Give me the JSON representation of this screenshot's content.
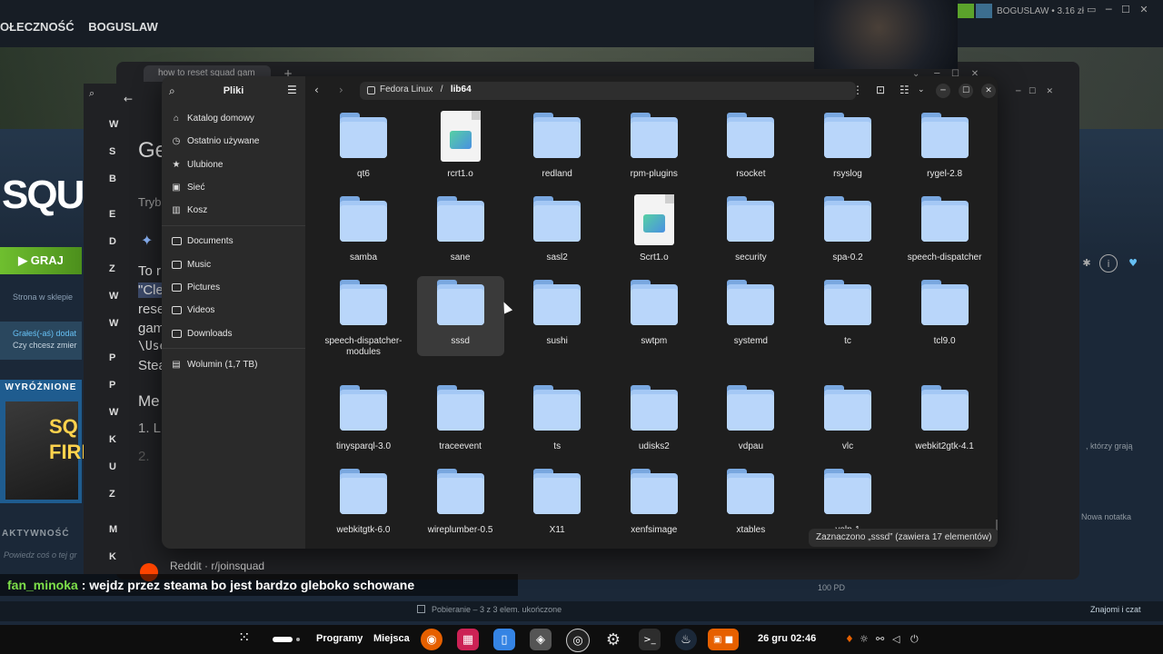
{
  "steam": {
    "nav": [
      "OŁECZNOŚĆ",
      "BOGUSLAW"
    ],
    "user": "BOGUSLAW • 3.16 zł",
    "logo": "SQUA",
    "play": "▶  GRAJ",
    "store_page": "Strona w sklepie",
    "played_line1": "Grałeś(-aś) dodat",
    "played_line2": "Czy chcesz zmier",
    "featured": "WYRÓŻNIONE",
    "featured_art": "SQ FIRE",
    "activity": "AKTYWNOŚĆ",
    "activity_placeholder": "Powiedz coś o tej gr",
    "friends_playing": ", którzy grają",
    "new_note": "Nowa notatka",
    "download": "Pobieranie – 3 z 3 elem. ukończone",
    "friends_chat": "Znajomi i czat",
    "size": "100 PD"
  },
  "browser": {
    "tab_title": "how to reset squad gam",
    "left_letters": [
      "W",
      "S",
      "B",
      "E",
      "D",
      "Z",
      "W",
      "W",
      "P",
      "P",
      "W",
      "K",
      "U",
      "Z",
      "M",
      "K"
    ],
    "content": [
      "Ge",
      "Tryb",
      "To r",
      "\"Cle",
      "rese",
      "gam",
      "\\Use",
      "Stea",
      "Me",
      "1. L",
      "2."
    ],
    "reddit": "Reddit · r/joinsquad"
  },
  "file_manager": {
    "title": "Pliki",
    "sidebar": {
      "places": [
        {
          "icon": "home-icon",
          "label": "Katalog domowy"
        },
        {
          "icon": "recent-icon",
          "label": "Ostatnio używane"
        },
        {
          "icon": "star-icon",
          "label": "Ulubione"
        },
        {
          "icon": "network-icon",
          "label": "Sieć"
        },
        {
          "icon": "trash-icon",
          "label": "Kosz"
        }
      ],
      "bookmarks": [
        "Documents",
        "Music",
        "Pictures",
        "Videos",
        "Downloads"
      ],
      "volume": "Wolumin (1,7 TB)"
    },
    "path": {
      "root": "Fedora Linux",
      "separator": "/",
      "current": "lib64"
    },
    "items": [
      {
        "name": "qt6",
        "type": "folder"
      },
      {
        "name": "rcrt1.o",
        "type": "file"
      },
      {
        "name": "redland",
        "type": "folder"
      },
      {
        "name": "rpm-plugins",
        "type": "folder"
      },
      {
        "name": "rsocket",
        "type": "folder"
      },
      {
        "name": "rsyslog",
        "type": "folder"
      },
      {
        "name": "rygel-2.8",
        "type": "folder"
      },
      {
        "name": "samba",
        "type": "folder"
      },
      {
        "name": "sane",
        "type": "folder"
      },
      {
        "name": "sasl2",
        "type": "folder"
      },
      {
        "name": "Scrt1.o",
        "type": "file"
      },
      {
        "name": "security",
        "type": "folder"
      },
      {
        "name": "spa-0.2",
        "type": "folder"
      },
      {
        "name": "speech-dispatcher",
        "type": "folder"
      },
      {
        "name": "speech-dispatcher-modules",
        "type": "folder"
      },
      {
        "name": "sssd",
        "type": "folder",
        "selected": true
      },
      {
        "name": "sushi",
        "type": "folder"
      },
      {
        "name": "swtpm",
        "type": "folder"
      },
      {
        "name": "systemd",
        "type": "folder"
      },
      {
        "name": "tc",
        "type": "folder"
      },
      {
        "name": "tcl9.0",
        "type": "folder"
      },
      {
        "name": "tinysparql-3.0",
        "type": "folder"
      },
      {
        "name": "traceevent",
        "type": "folder"
      },
      {
        "name": "ts",
        "type": "folder"
      },
      {
        "name": "udisks2",
        "type": "folder"
      },
      {
        "name": "vdpau",
        "type": "folder"
      },
      {
        "name": "vlc",
        "type": "folder"
      },
      {
        "name": "webkit2gtk-4.1",
        "type": "folder"
      },
      {
        "name": "webkitgtk-6.0",
        "type": "folder"
      },
      {
        "name": "wireplumber-0.5",
        "type": "folder"
      },
      {
        "name": "X11",
        "type": "folder"
      },
      {
        "name": "xenfsimage",
        "type": "folder"
      },
      {
        "name": "xtables",
        "type": "folder"
      },
      {
        "name": "yelp-1",
        "type": "folder"
      }
    ],
    "status": "Zaznaczono „sssd” (zawiera 17 elementów)"
  },
  "chat": {
    "user": "fan_minoka",
    "message": " : wejdz przez steama bo jest bardzo gleboko schowane"
  },
  "taskbar": {
    "programs": "Programy",
    "places": "Miejsca",
    "clock": "26 gru  02:46"
  }
}
